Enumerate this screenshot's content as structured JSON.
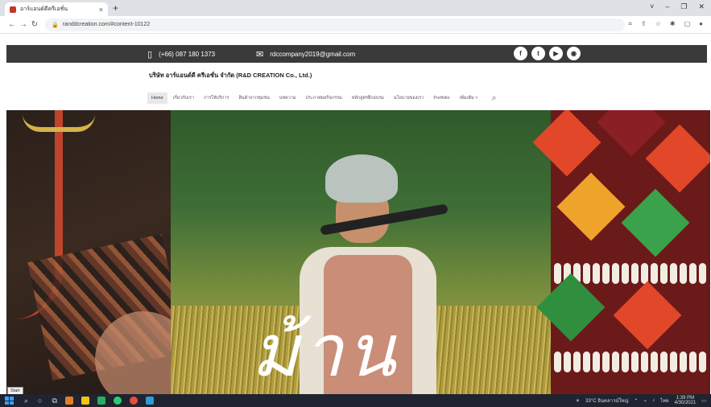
{
  "browser": {
    "tab_title": "อาร์แอนด์ดีครีเอชั่น",
    "tab_close": "×",
    "new_tab": "+",
    "url": "randdcreation.com/#content-10122",
    "controls": [
      "˅",
      "–",
      "❐",
      "✕"
    ]
  },
  "header": {
    "phone": "(+66) 087 180 1373",
    "email": "rdccompany2019@gmail.com",
    "company_name": "บริษัท อาร์แอนด์ดี ครีเอชั่น จำกัด (R&D CREATION Co., Ltd.)"
  },
  "social_icons": [
    "facebook-icon",
    "twitter-icon",
    "youtube-icon",
    "line-icon"
  ],
  "menu": [
    "Home",
    "เกี่ยวกับเรา",
    "การให้บริการ",
    "สินค้าจากชุมชน",
    "บทความ",
    "ประกาศผลกิจกรรม",
    "หลักสูตรฝึกอบรม",
    "นโยบายของเรา",
    "Portfolio",
    "เพิ่มเติม"
  ],
  "menu_active": "Home",
  "hero": {
    "script_text": "ม้าน"
  },
  "taskbar": {
    "start_tooltip": "Start",
    "weather": "33°C อินคลาวน์ใหญ่",
    "lang": "ไทย",
    "time": "1:39 PM",
    "date": "4/30/2021"
  },
  "colors": {
    "top_strip": "#3a3a3a",
    "taskbar": "#1f2430",
    "accent_red": "#c0442c"
  }
}
